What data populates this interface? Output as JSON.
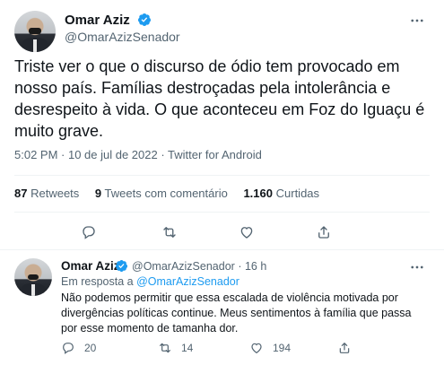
{
  "main_tweet": {
    "author_name": "Omar Aziz",
    "author_handle": "@OmarAzizSenador",
    "text": "Triste ver o que o discurso de ódio tem provocado em nosso país. Famílias destroçadas pela intolerância e desrespeito à vida. O que aconteceu em Foz do Iguaçu é muito grave.",
    "meta": "5:02 PM · 10 de jul de 2022 · Twitter for Android",
    "retweets_count": "87",
    "retweets_label": "Retweets",
    "quotes_count": "9",
    "quotes_label": "Tweets com comentário",
    "likes_count": "1.160",
    "likes_label": "Curtidas"
  },
  "reply_tweet": {
    "author_name": "Omar Aziz",
    "author_handle": "@OmarAzizSenador",
    "separator": "·",
    "time": "16 h",
    "in_reply_prefix": "Em resposta a",
    "in_reply_handle": "@OmarAzizSenador",
    "text": "Não podemos permitir que essa escalada de violência motivada por divergências políticas continue. Meus sentimentos à família que passa por esse momento de tamanha dor.",
    "reply_count": "20",
    "retweet_count": "14",
    "like_count": "194"
  },
  "colors": {
    "verified": "#1d9bf0",
    "secondary_text": "#536471",
    "link": "#1d9bf0",
    "divider": "#eff3f4"
  },
  "icons": [
    "verified-icon",
    "more-icon",
    "reply-icon",
    "retweet-icon",
    "like-icon",
    "share-icon"
  ]
}
